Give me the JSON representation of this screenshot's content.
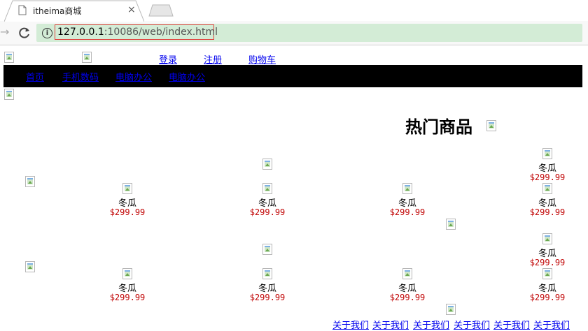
{
  "browser": {
    "tab_title": "itheima商城",
    "tab_close": "×",
    "url_host": "127.0.0.1",
    "url_path": ":10086/web/index.html",
    "back_icon": "→",
    "info_icon": "i"
  },
  "header": {
    "login": "登录",
    "register": "注册",
    "cart": "购物车"
  },
  "nav": {
    "items": [
      "首页",
      "手机数码",
      "电脑办公",
      "电脑办公"
    ]
  },
  "hot": {
    "title": "热门商品"
  },
  "products": {
    "name": "冬瓜",
    "price": "$299.99"
  },
  "footer": {
    "links": [
      "关于我们",
      "关于我们",
      "关于我们",
      "关于我们",
      "关于我们",
      "关于我们"
    ]
  },
  "colors": {
    "nav_bg": "#000000",
    "price": "#c00000",
    "link": "#0000ee",
    "omnibox": "#d3ecd6",
    "url_highlight": "#e0403c"
  }
}
